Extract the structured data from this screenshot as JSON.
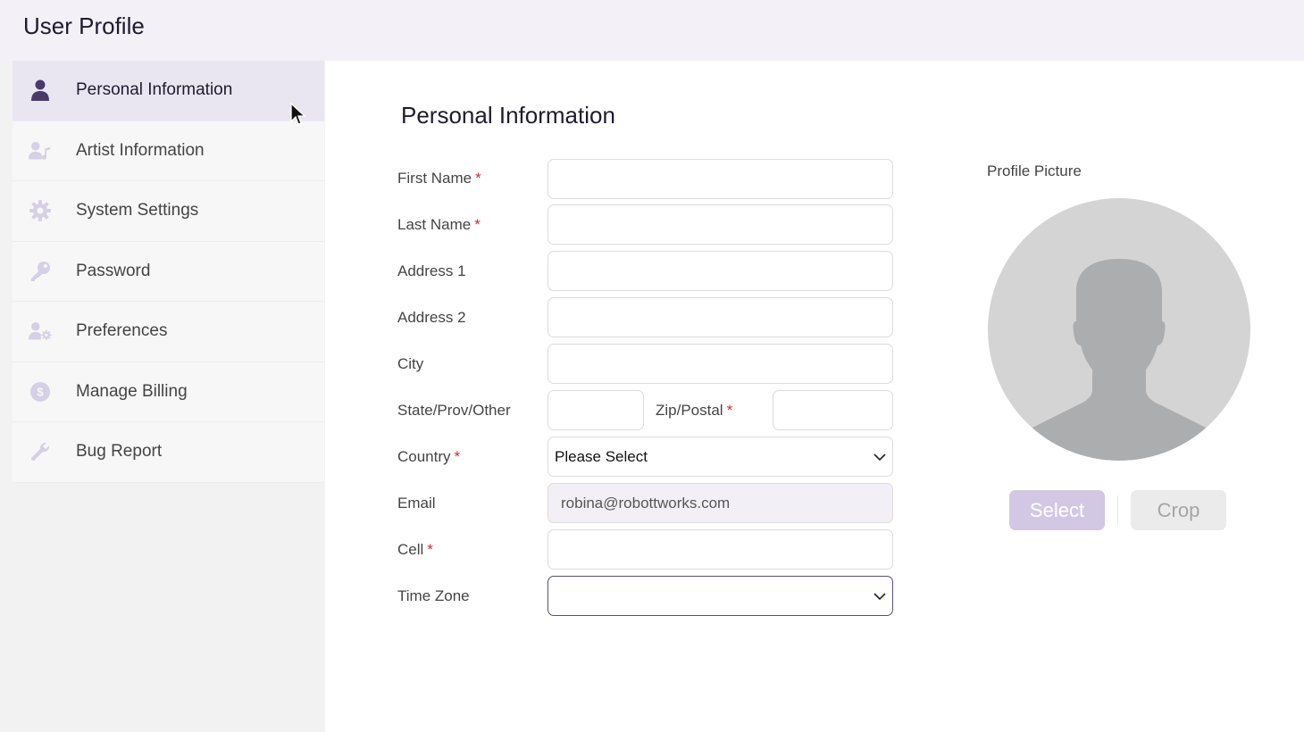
{
  "header": {
    "title": "User Profile"
  },
  "sidebar": {
    "items": [
      {
        "label": "Personal Information",
        "icon": "user-icon",
        "active": true
      },
      {
        "label": "Artist Information",
        "icon": "user-music-icon",
        "active": false
      },
      {
        "label": "System Settings",
        "icon": "gear-icon",
        "active": false
      },
      {
        "label": "Password",
        "icon": "key-icon",
        "active": false
      },
      {
        "label": "Preferences",
        "icon": "user-gear-icon",
        "active": false
      },
      {
        "label": "Manage Billing",
        "icon": "dollar-circle-icon",
        "active": false
      },
      {
        "label": "Bug Report",
        "icon": "wrench-icon",
        "active": false
      }
    ]
  },
  "main": {
    "heading": "Personal Information",
    "form": {
      "first_name": {
        "label": "First Name",
        "required": "*",
        "value": ""
      },
      "last_name": {
        "label": "Last Name",
        "required": "*",
        "value": ""
      },
      "address1": {
        "label": "Address 1",
        "value": ""
      },
      "address2": {
        "label": "Address 2",
        "value": ""
      },
      "city": {
        "label": "City",
        "value": ""
      },
      "state": {
        "label": "State/Prov/Other",
        "value": ""
      },
      "zip": {
        "label": "Zip/Postal",
        "required": "*",
        "value": ""
      },
      "country": {
        "label": "Country",
        "required": "*",
        "selected": "Please Select"
      },
      "email": {
        "label": "Email",
        "value": "robina@robottworks.com"
      },
      "cell": {
        "label": "Cell",
        "required": "*",
        "value": ""
      },
      "timezone": {
        "label": "Time Zone",
        "selected": ""
      }
    },
    "profile_picture": {
      "label": "Profile Picture",
      "select_label": "Select",
      "crop_label": "Crop"
    }
  },
  "colors": {
    "accent": "#4a3a6b",
    "accent_light": "#d2c8e4",
    "required": "#e0262f",
    "active_nav": "#eae6f1"
  }
}
